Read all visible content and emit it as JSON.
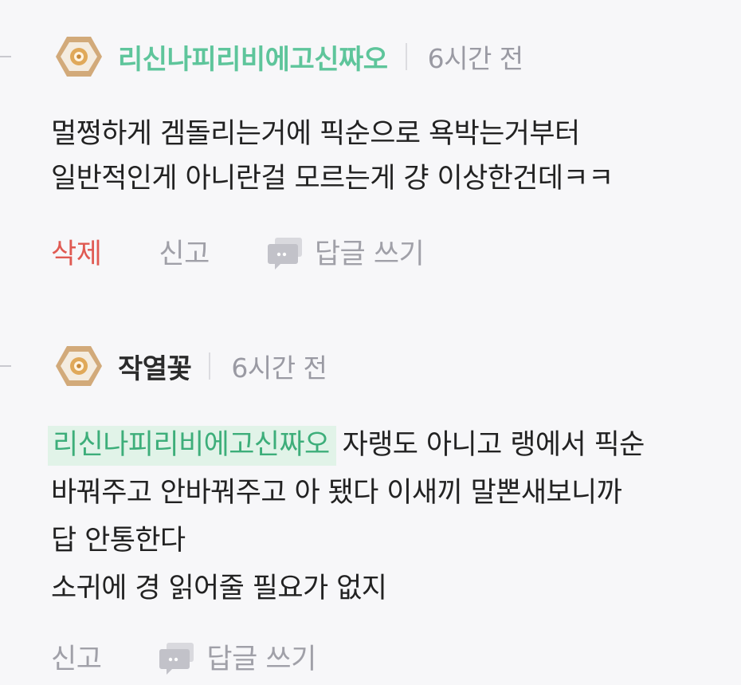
{
  "comments": [
    {
      "username": "리신나피리비에고신짜오",
      "time": "6시간 전",
      "lines": [
        "멀쩡하게 겜돌리는거에 픽순으로 욕박는거부터",
        "일반적인게 아니란걸 모르는게 걍 이상한건데ㅋㅋ"
      ],
      "actions": {
        "delete": "삭제",
        "report": "신고",
        "reply": "답글 쓰기"
      }
    },
    {
      "username": "작열꽃",
      "time": "6시간 전",
      "mention": "리신나피리비에고신짜오",
      "lines": [
        "자랭도 아니고 랭에서 픽순",
        "바꿔주고 안바꿔주고 아 됐다 이새끼 말뽄새보니까",
        "답 안통한다",
        "소귀에 경 읽어줄 필요가 없지"
      ],
      "actions": {
        "report": "신고",
        "reply": "답글 쓰기"
      }
    }
  ],
  "icons": {
    "badge": "hexagon-rank-badge-icon",
    "reply": "chat-bubble-icon"
  },
  "colors": {
    "username_highlight": "#5ec59b",
    "delete": "#e05a52",
    "muted": "#a0a0a8",
    "mention_bg": "#e1f3e8"
  }
}
